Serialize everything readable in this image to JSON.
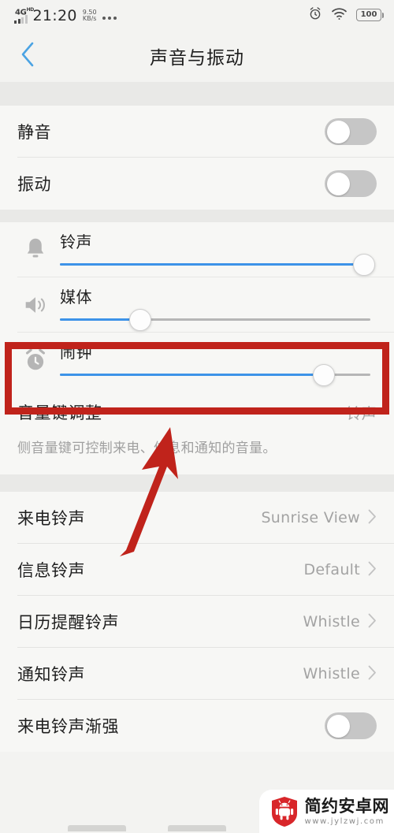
{
  "status_bar": {
    "network_label": "4G",
    "network_sup": "HD",
    "time": "21:20",
    "net_speed_value": "9.50",
    "net_speed_unit": "KB/s",
    "overflow_icon": "more-dots-icon",
    "alarm_icon": "alarm-clock-icon",
    "wifi_icon": "wifi-icon",
    "battery_level": "100"
  },
  "header": {
    "back_icon": "chevron-left-icon",
    "title": "声音与振动",
    "accent_color": "#4ba3e3"
  },
  "toggles": [
    {
      "label": "静音",
      "state": "off",
      "icon": "toggle-switch"
    },
    {
      "label": "振动",
      "state": "off",
      "icon": "toggle-switch"
    }
  ],
  "sliders": [
    {
      "label": "铃声",
      "icon": "bell-icon",
      "value": 98,
      "fill_color": "#3d93e8"
    },
    {
      "label": "媒体",
      "icon": "speaker-icon",
      "value": 26,
      "fill_color": "#3d93e8"
    },
    {
      "label": "闹钟",
      "icon": "alarm-clock-icon",
      "value": 85,
      "fill_color": "#3d93e8"
    }
  ],
  "volume_key": {
    "label": "音量键调整",
    "value": "铃声",
    "description": "侧音量键可控制来电、信息和通知的音量。"
  },
  "ringtone_rows": [
    {
      "label": "来电铃声",
      "value": "Sunrise View",
      "chevron": "chevron-right-icon"
    },
    {
      "label": "信息铃声",
      "value": "Default",
      "chevron": "chevron-right-icon"
    },
    {
      "label": "日历提醒铃声",
      "value": "Whistle",
      "chevron": "chevron-right-icon"
    },
    {
      "label": "通知铃声",
      "value": "Whistle",
      "chevron": "chevron-right-icon"
    }
  ],
  "bottom_toggle": {
    "label": "来电铃声渐强",
    "state": "off"
  },
  "annotations": {
    "highlight_box": {
      "color": "#c0231b",
      "target": "闹钟"
    },
    "arrow": {
      "color": "#c0231b",
      "points_to": "闹钟"
    }
  },
  "watermark": {
    "site_name": "简约安卓网",
    "url": "www.jylzwj.com",
    "logo_icon": "android-shield-icon",
    "logo_color": "#d8262a"
  }
}
